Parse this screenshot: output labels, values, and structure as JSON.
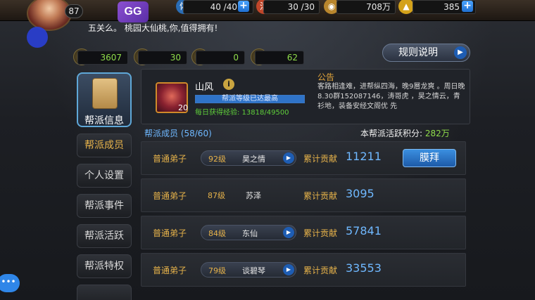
{
  "top": {
    "level": "87",
    "stamina": "40 /40",
    "vigor": "30 /30",
    "coins": "708万",
    "ingots": "385",
    "stamina_icon": "体",
    "vigor_icon": "活"
  },
  "marquee": "五关么。 桃园大仙桃,你,值得拥有!",
  "stats": [
    "3607",
    "30",
    "0",
    "62"
  ],
  "rules_button": "规则说明",
  "nav": {
    "top_label": "帮派信息",
    "items": [
      "帮派成员",
      "个人设置",
      "帮派事件",
      "帮派活跃",
      "帮派特权"
    ]
  },
  "guild": {
    "name": "山风",
    "level": "20",
    "exp_status": "帮派等级已达最高",
    "daily_exp": "每日获得经验: 13818/49500",
    "notice_title": "公告",
    "notice_text": "客路相逢难，进帮纵四海，晚9層龙爽 。周日晚8.30群152087146，涛哥虎 ，昊之情云，青衫地，装备安经文阁优 先"
  },
  "members": {
    "title": "帮派成员 (58/60)",
    "activity_label": "本帮派活跃积分:",
    "activity_value": "282万",
    "contrib_label": "累计贡献",
    "worship_label": "膜拜",
    "rows": [
      {
        "rank": "普通弟子",
        "level": "92级",
        "name": "昊之情",
        "contrib": "11211"
      },
      {
        "rank": "普通弟子",
        "level": "87级",
        "name": "苏泽",
        "contrib": "3095"
      },
      {
        "rank": "普通弟子",
        "level": "84级",
        "name": "东仙",
        "contrib": "57841"
      },
      {
        "rank": "普通弟子",
        "level": "79级",
        "name": "谈碧琴",
        "contrib": "33553"
      }
    ]
  },
  "chat": "•••",
  "gg": "GG"
}
